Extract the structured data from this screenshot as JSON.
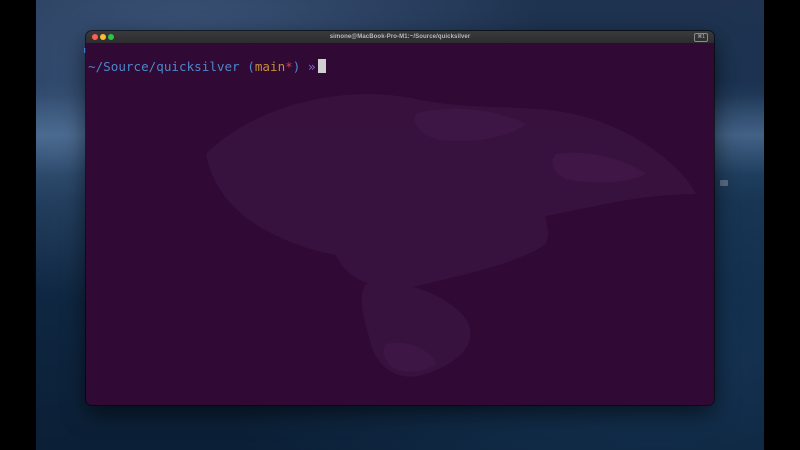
{
  "window": {
    "title": "simone@MacBook-Pro-M1:~/Source/quicksilver",
    "tab_indicator": "⌘1"
  },
  "prompt": {
    "path": "~/Source/quicksilver",
    "branch_open": " (",
    "branch": "main",
    "dirty_marker": "*",
    "branch_close": ")",
    "symbol": " »"
  },
  "colors": {
    "terminal_background": "#300a34",
    "path": "#4e86c9",
    "branch": "#c38e3a",
    "dirty_marker": "#c64a4a",
    "prompt_symbol": "#7a6fd0",
    "cursor": "#cfcfd4",
    "close_button": "#fe5f57",
    "minimize_button": "#febc2e",
    "zoom_button": "#28c840"
  },
  "icons": {
    "close": "close-icon",
    "minimize": "minimize-icon",
    "zoom": "zoom-icon"
  }
}
